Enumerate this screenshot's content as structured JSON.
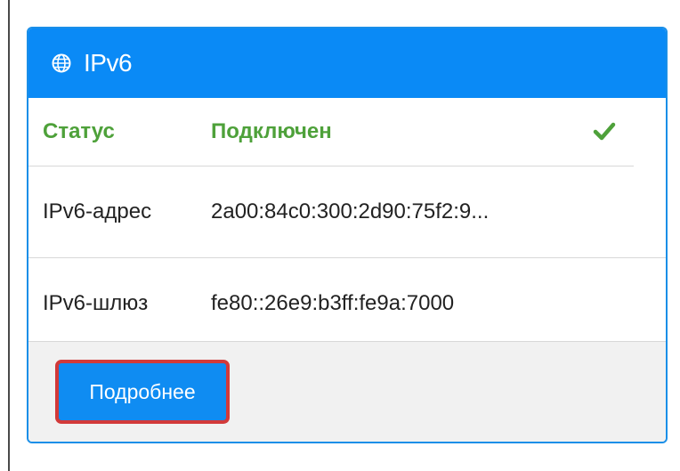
{
  "panel": {
    "title": "IPv6",
    "header_icon": "globe-icon",
    "header_color": "#0a8af6"
  },
  "rows": [
    {
      "label": "Статус",
      "value": "Подключен",
      "status_icon": "checkmark-icon",
      "status_color": "#4ea13a"
    },
    {
      "label": "IPv6-адрес",
      "value": "2a00:84c0:300:2d90:75f2:9..."
    },
    {
      "label": "IPv6-шлюз",
      "value": "fe80::26e9:b3ff:fe9a:7000"
    }
  ],
  "footer": {
    "details_label": "Подробнее",
    "button_color": "#0f8cf2",
    "highlight_color": "#d23a3a"
  }
}
